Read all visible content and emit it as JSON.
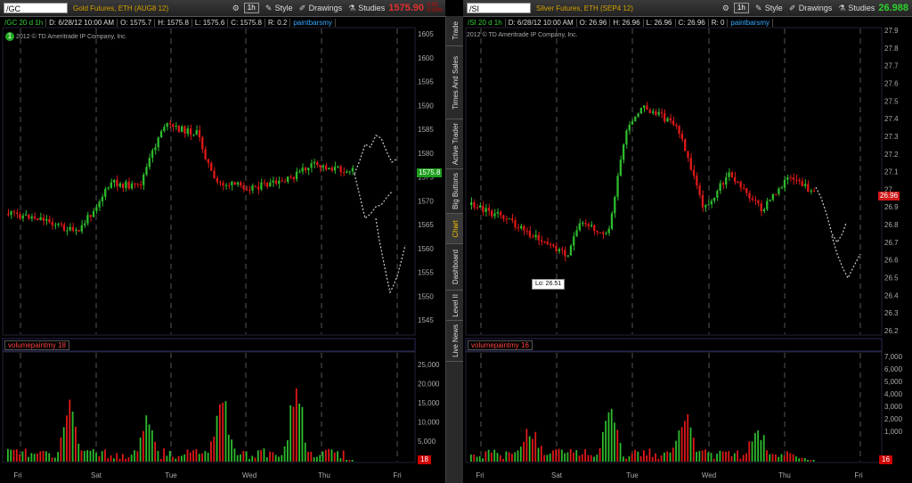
{
  "left": {
    "symbol": "/GC",
    "description": "Gold Futures, ETH (AUG8 12)",
    "price": "1575.90",
    "change_up": "-0.50",
    "change_down": "-0.03%",
    "info_symbol": "/GC 20 d 1h",
    "info_date": "D: 6/28/12 10:00 AM",
    "info_open": "O: 1575.7",
    "info_high": "H: 1575.8",
    "info_low": "L: 1575.6",
    "info_close": "C: 1575.8",
    "info_range": "R: 0.2",
    "study": "paintbarsmy",
    "copyright": "2012 © TD Ameritrade IP Company, Inc.",
    "copyright_badge": "1",
    "price_tag": "1575.8",
    "price_ticks": [
      "1605",
      "1600",
      "1595",
      "1590",
      "1585",
      "1580",
      "1575",
      "1570",
      "1565",
      "1560",
      "1555",
      "1550",
      "1545"
    ],
    "vol_ticks": [
      "25,000",
      "20,000",
      "15,000",
      "10,000",
      "5,000"
    ],
    "vol_study": "volumepaintmy",
    "vol_study_value": "18",
    "vol_count": "18",
    "days": [
      "Fri",
      "Sat",
      "Tue",
      "Wed",
      "Thu",
      "Fri"
    ]
  },
  "right": {
    "symbol": "/SI",
    "description": "Silver Futures, ETH (SEP4 12)",
    "price": "26.988",
    "info_symbol": "/SI 20 d 1h",
    "info_date": "D: 6/28/12 10:00 AM",
    "info_open": "O: 26.96",
    "info_high": "H: 26.96",
    "info_low": "L: 26.96",
    "info_close": "C: 26.96",
    "info_range": "R: 0",
    "study": "paintbarsmy",
    "copyright": "2012 © TD Ameritrade IP Company, Inc.",
    "price_tag": "26.96",
    "lo_label": "Lo: 26.51",
    "price_ticks": [
      "27.9",
      "27.8",
      "27.7",
      "27.6",
      "27.5",
      "27.4",
      "27.3",
      "27.2",
      "27.1",
      "27",
      "26.9",
      "26.8",
      "26.7",
      "26.6",
      "26.5",
      "26.4",
      "26.3",
      "26.2"
    ],
    "vol_ticks": [
      "7,000",
      "6,000",
      "5,000",
      "4,000",
      "3,000",
      "2,000",
      "1,000"
    ],
    "vol_study": "volumepaintmy",
    "vol_study_value": "16",
    "vol_count": "16",
    "days": [
      "Fri",
      "Sat",
      "Tue",
      "Wed",
      "Thu",
      "Fri"
    ]
  },
  "toolbar": {
    "timeframe": "1h",
    "style": "Style",
    "drawings": "Drawings",
    "studies": "Studies"
  },
  "sidebar": [
    "Trade",
    "Times And Sales",
    "Active Trader",
    "Big Buttons",
    "Chart",
    "Dashboard",
    "Level II",
    "Live News"
  ],
  "colors": {
    "up": "#2dbb2d",
    "down": "#e01818",
    "accent": "#f2c200",
    "study": "#33aaff"
  }
}
